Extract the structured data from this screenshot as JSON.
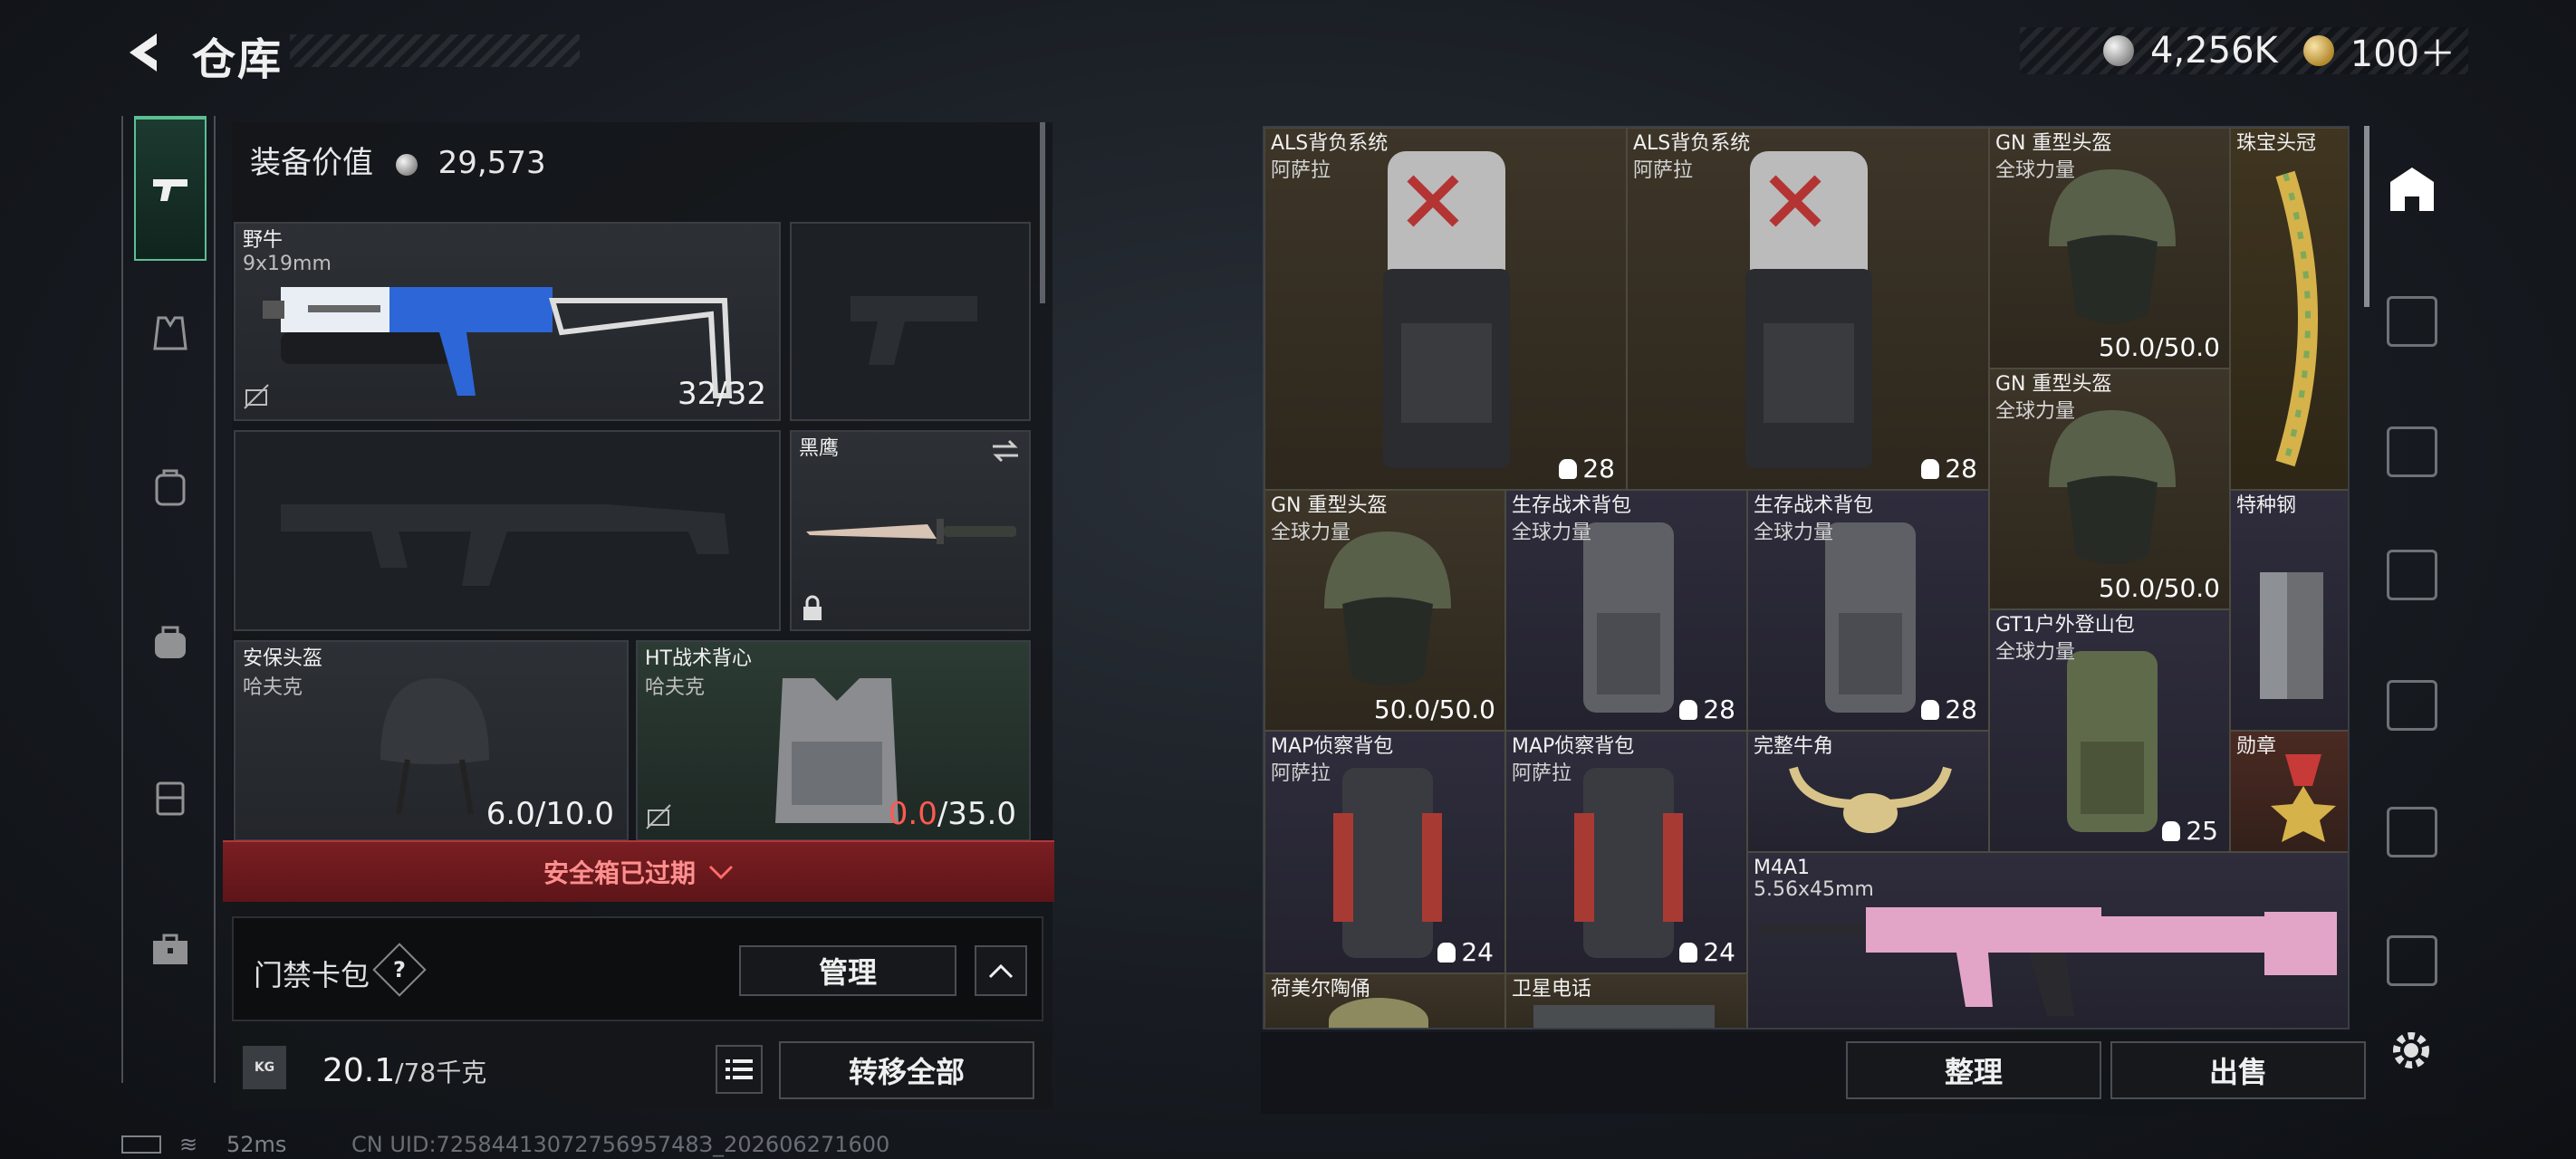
{
  "header": {
    "title": "仓库"
  },
  "currency": {
    "silver": "4,256K",
    "gold": "100＋"
  },
  "loadout": {
    "equip_value_label": "装备价值",
    "equip_value": "29,573",
    "slots": {
      "primary": {
        "name": "野牛",
        "ammo": "9x19mm",
        "count": "32/32"
      },
      "melee": {
        "name": "黑鹰"
      },
      "helmet": {
        "name": "安保头盔",
        "maker": "哈夫克",
        "durability": "6.0/10.0"
      },
      "vest": {
        "name": "HT战术背心",
        "maker": "哈夫克",
        "durability_current": "0.0",
        "durability_max": "/35.0"
      }
    },
    "safe_box_status": "安全箱已过期",
    "keycard": {
      "label": "门禁卡包",
      "help": "?",
      "manage_label": "管理"
    },
    "weight": {
      "current": "20.1",
      "max": "/78千克",
      "icon_label": "KG"
    },
    "transfer_all_label": "转移全部"
  },
  "storage": {
    "items": [
      {
        "name": "ALS背负系统",
        "sub": "阿萨拉",
        "info": "28"
      },
      {
        "name": "ALS背负系统",
        "sub": "阿萨拉",
        "info": "28"
      },
      {
        "name": "GN 重型头盔",
        "sub": "全球力量",
        "info": "50.0/50.0"
      },
      {
        "name": "珠宝头冠",
        "sub": "",
        "info": ""
      },
      {
        "name": "GN 重型头盔",
        "sub": "全球力量",
        "info": "50.0/50.0"
      },
      {
        "name": "GN 重型头盔",
        "sub": "全球力量",
        "info": "50.0/50.0"
      },
      {
        "name": "生存战术背包",
        "sub": "全球力量",
        "info": "28"
      },
      {
        "name": "生存战术背包",
        "sub": "全球力量",
        "info": "28"
      },
      {
        "name": "特种钢",
        "sub": "",
        "info": ""
      },
      {
        "name": "GT1户外登山包",
        "sub": "全球力量",
        "info": "25"
      },
      {
        "name": "MAP侦察背包",
        "sub": "阿萨拉",
        "info": "24"
      },
      {
        "name": "MAP侦察背包",
        "sub": "阿萨拉",
        "info": "24"
      },
      {
        "name": "完整牛角",
        "sub": "",
        "info": ""
      },
      {
        "name": "勋章",
        "sub": "",
        "info": ""
      },
      {
        "name": "M4A1",
        "sub": "5.56x45mm",
        "info": ""
      },
      {
        "name": "荷美尔陶俑",
        "sub": "",
        "info": ""
      },
      {
        "name": "卫星电话",
        "sub": "",
        "info": ""
      }
    ],
    "sort_label": "整理",
    "sell_label": "出售"
  },
  "status": {
    "ping": "52ms",
    "uid": "CN UID:7258441307275695748З_202606271600"
  },
  "colors": {
    "accent_green": "#5bbf93",
    "alert_red": "#ff5a50",
    "banner_red": "#7a1e22"
  },
  "icons": [
    "back-arrow-icon",
    "pistol-icon",
    "vest-icon",
    "backpack-icon",
    "bag-icon",
    "case-icon",
    "toolbox-icon",
    "list-icon",
    "settings-icon",
    "swap-icon",
    "lock-icon",
    "shelf-icon"
  ]
}
